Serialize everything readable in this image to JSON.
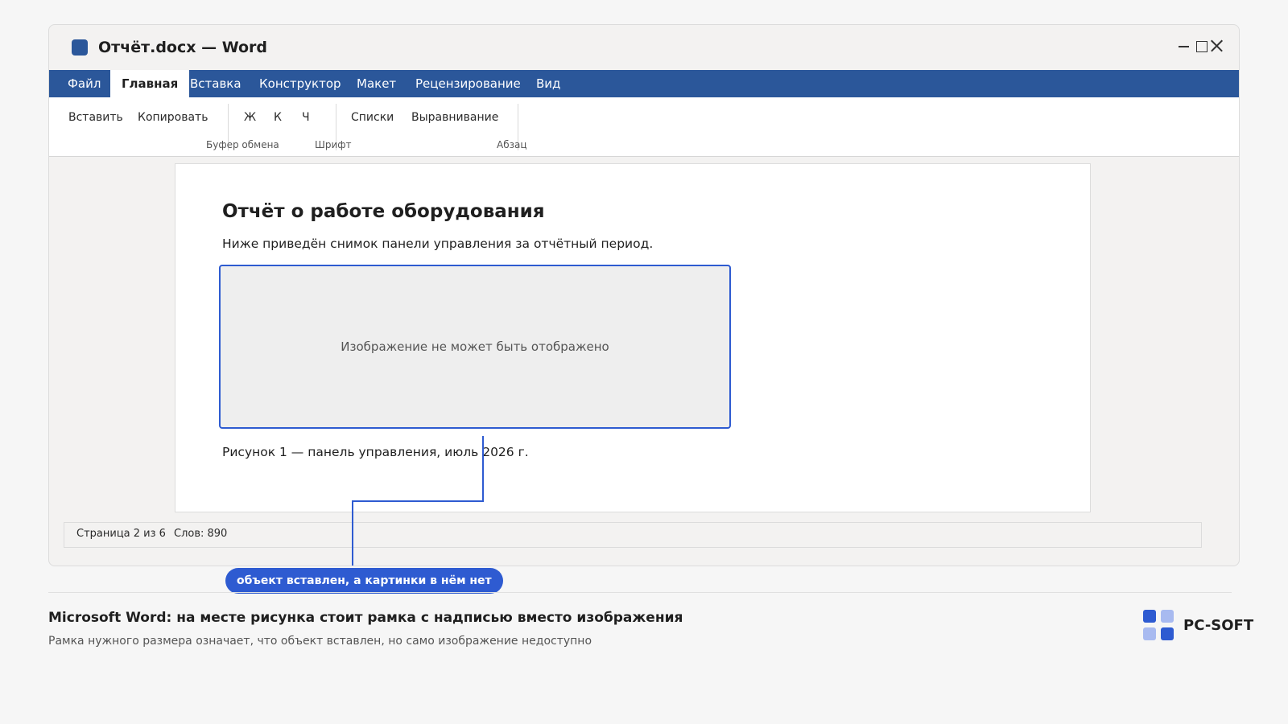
{
  "window": {
    "title": "Отчёт.docx — Word"
  },
  "tabs": [
    "Файл",
    "Главная",
    "Вставка",
    "Конструктор",
    "Макет",
    "Рецензирование",
    "Вид"
  ],
  "active_tab": "Главная",
  "ribbon": {
    "buttons": {
      "paste": "Вставить",
      "copy": "Копировать",
      "bold": "Ж",
      "italic": "К",
      "underline": "Ч",
      "lists": "Списки",
      "align": "Выравнивание"
    },
    "groups": {
      "clipboard": "Буфер обмена",
      "font": "Шрифт",
      "paragraph": "Абзац"
    }
  },
  "document": {
    "heading": "Отчёт о работе оборудования",
    "paragraph": "Ниже приведён снимок панели управления за отчётный период.",
    "image_placeholder": "Изображение не может быть отображено",
    "caption": "Рисунок 1 — панель управления, июль 2026 г."
  },
  "status": {
    "page": "Страница 2 из 6",
    "words": "Слов: 890"
  },
  "callout": "объект вставлен, а картинки в нём нет",
  "footer": {
    "title": "Microsoft Word: на месте рисунка стоит рамка с надписью вместо изображения",
    "subtitle": "Рамка нужного размера означает, что объект вставлен, но само изображение недоступно",
    "logo_text": "PC-SOFT"
  },
  "colors": {
    "accent": "#2b579a",
    "highlight": "#2e5bd1",
    "logo_dark": "#2e5bd1",
    "logo_light": "#a8baf0"
  },
  "icons": [
    "word-app-icon",
    "minimize-icon",
    "maximize-icon",
    "close-icon",
    "pc-soft-logo-icon"
  ]
}
